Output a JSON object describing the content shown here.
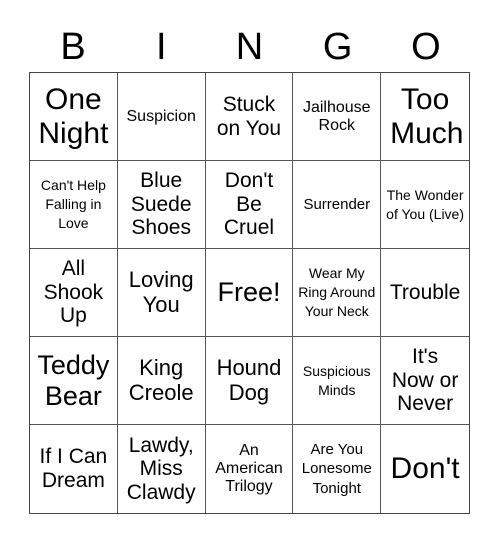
{
  "header": {
    "letters": [
      "B",
      "I",
      "N",
      "G",
      "O"
    ]
  },
  "cells": [
    {
      "text": "One Night"
    },
    {
      "text": "Suspicion"
    },
    {
      "text": "Stuck on You"
    },
    {
      "text": "Jailhouse Rock"
    },
    {
      "text": "Too Much"
    },
    {
      "text": "Can't Help Falling in Love"
    },
    {
      "text": "Blue Suede Shoes"
    },
    {
      "text": "Don't Be Cruel"
    },
    {
      "text": "Surrender"
    },
    {
      "text": "The Wonder of You (Live)"
    },
    {
      "text": "All Shook Up"
    },
    {
      "text": "Loving You"
    },
    {
      "text": "Free!"
    },
    {
      "text": "Wear My Ring Around Your Neck"
    },
    {
      "text": "Trouble"
    },
    {
      "text": "Teddy Bear"
    },
    {
      "text": "King Creole"
    },
    {
      "text": "Hound Dog"
    },
    {
      "text": "Suspicious Minds"
    },
    {
      "text": "It's Now or Never"
    },
    {
      "text": "If I Can Dream"
    },
    {
      "text": "Lawdy, Miss Clawdy"
    },
    {
      "text": "An American Trilogy"
    },
    {
      "text": "Are You Lonesome Tonight"
    },
    {
      "text": "Don't"
    }
  ]
}
